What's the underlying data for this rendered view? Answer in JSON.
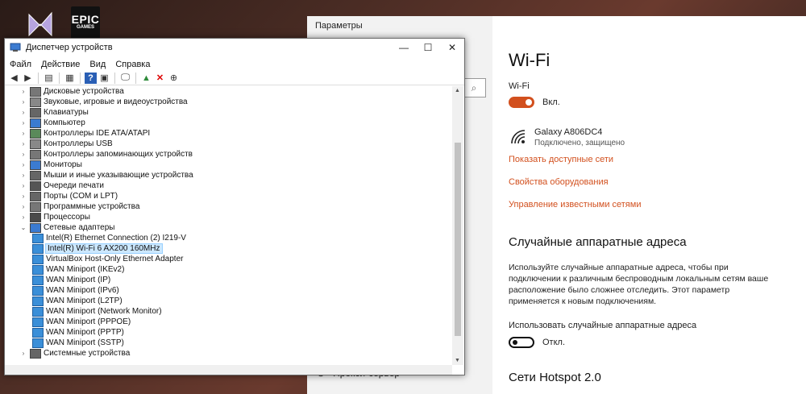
{
  "desktop": {
    "epic_label_1": "EPIC",
    "epic_label_2": "GAMES"
  },
  "settings": {
    "window_title": "Параметры",
    "nav_proxy": "Прокси-сервер",
    "page_title": "Wi-Fi",
    "wifi_label": "Wi-Fi",
    "wifi_state": "Вкл.",
    "network_name": "Galaxy A806DC4",
    "network_status": "Подключено, защищено",
    "links": [
      "Показать доступные сети",
      "Свойства оборудования",
      "Управление известными сетями"
    ],
    "random_hw_title": "Случайные аппаратные адреса",
    "random_hw_desc": "Используйте случайные аппаратные адреса, чтобы при подключении к различным беспроводным локальным сетям ваше расположение было сложнее отследить. Этот параметр применяется к новым подключениям.",
    "random_hw_toggle_label": "Использовать случайные аппаратные адреса",
    "random_hw_state": "Откл.",
    "hotspot_title": "Сети Hotspot 2.0",
    "accent": "#d2501e"
  },
  "devmgr": {
    "title": "Диспетчер устройств",
    "menu": [
      "Файл",
      "Действие",
      "Вид",
      "Справка"
    ],
    "categories": [
      "Дисковые устройства",
      "Звуковые, игровые и видеоустройства",
      "Клавиатуры",
      "Компьютер",
      "Контроллеры IDE ATA/ATAPI",
      "Контроллеры USB",
      "Контроллеры запоминающих устройств",
      "Мониторы",
      "Мыши и иные указывающие устройства",
      "Очереди печати",
      "Порты (COM и LPT)",
      "Программные устройства",
      "Процессоры",
      "Сетевые адаптеры"
    ],
    "network_adapters": [
      "Intel(R) Ethernet Connection (2) I219-V",
      "Intel(R) Wi-Fi 6 AX200 160MHz",
      "VirtualBox Host-Only Ethernet Adapter",
      "WAN Miniport (IKEv2)",
      "WAN Miniport (IP)",
      "WAN Miniport (IPv6)",
      "WAN Miniport (L2TP)",
      "WAN Miniport (Network Monitor)",
      "WAN Miniport (PPPOE)",
      "WAN Miniport (PPTP)",
      "WAN Miniport (SSTP)"
    ],
    "last_category": "Системные устройства"
  }
}
